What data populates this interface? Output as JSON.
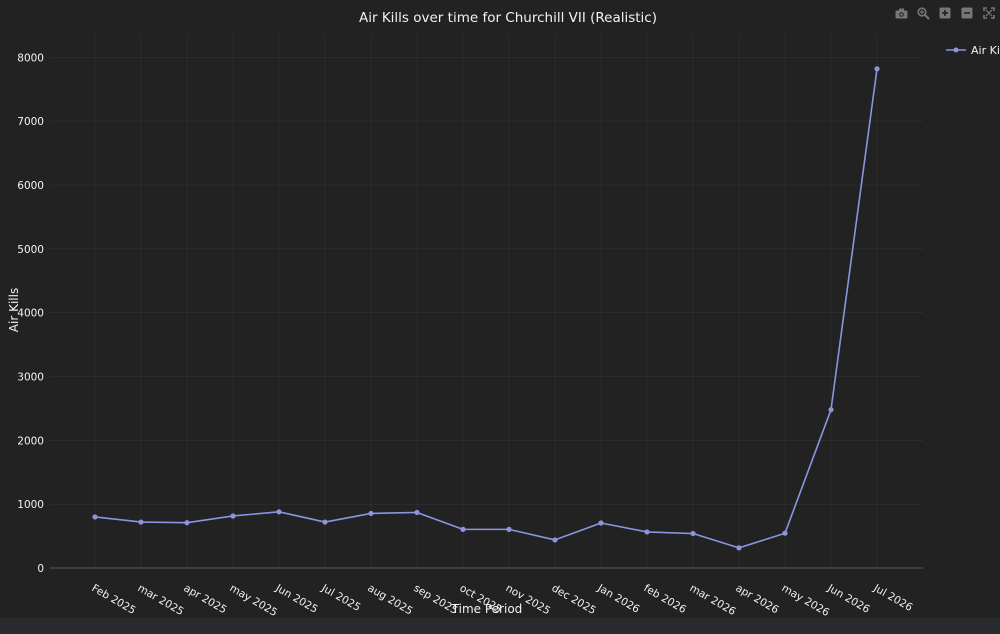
{
  "toolbar": {
    "buttons": [
      "camera-icon",
      "zoom-icon",
      "zoom-in-icon",
      "zoom-out-icon",
      "autoscale-icon"
    ]
  },
  "colors": {
    "background": "#222222",
    "line": "#8b95df",
    "grid": "#333333",
    "text": "#f2f2f2"
  },
  "chart_data": {
    "type": "line",
    "title": "Air Kills over time for Churchill VII (Realistic)",
    "xlabel": "Time Period",
    "ylabel": "Air Kills",
    "categories": [
      "Feb 2025",
      "mar 2025",
      "apr 2025",
      "may 2025",
      "Jun 2025",
      "Jul 2025",
      "aug 2025",
      "sep 2025",
      "oct 2025",
      "nov 2025",
      "dec 2025",
      "Jan 2026",
      "feb 2026",
      "mar 2026",
      "apr 2026",
      "may 2026",
      "Jun 2026",
      "Jul 2026"
    ],
    "series": [
      {
        "name": "Air Kills",
        "values": [
          800,
          720,
          710,
          815,
          880,
          720,
          855,
          870,
          605,
          605,
          440,
          705,
          565,
          540,
          315,
          545,
          2480,
          7820
        ]
      }
    ],
    "ylim": [
      0,
      8350
    ],
    "yticks": [
      0,
      1000,
      2000,
      3000,
      4000,
      5000,
      6000,
      7000,
      8000
    ],
    "ytick_labels": [
      "0",
      "1000",
      "2000",
      "3000",
      "4000",
      "5000",
      "6000",
      "7000",
      "8000"
    ],
    "grid": true,
    "legend": "top-right"
  }
}
